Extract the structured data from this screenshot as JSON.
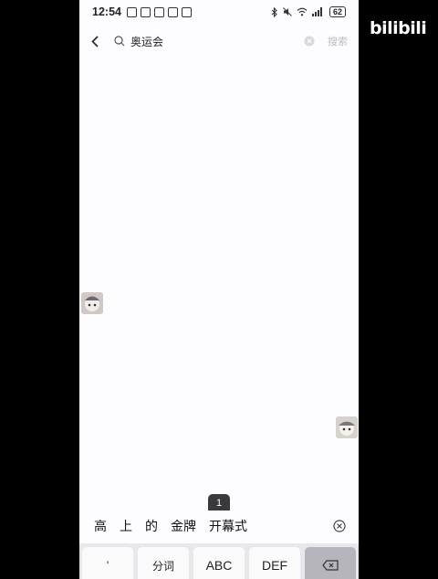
{
  "status_bar": {
    "time": "12:54",
    "battery": "62"
  },
  "search": {
    "query": "奥运会",
    "button_label": "搜索"
  },
  "ime": {
    "candidates": [
      "高",
      "上",
      "的",
      "金牌",
      "开幕式"
    ],
    "key_popup": "1",
    "keys": [
      "'",
      "分词",
      "ABC",
      "DEF"
    ]
  },
  "watermark": {
    "logo_text": "bilibili"
  }
}
